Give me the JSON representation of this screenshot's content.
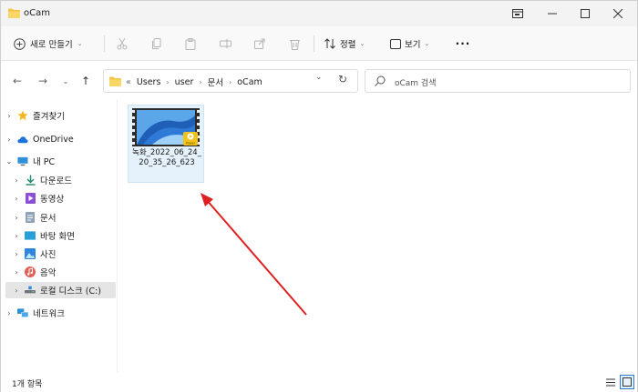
{
  "window": {
    "title": "oCam"
  },
  "toolbar": {
    "new_label": "새로 만들기",
    "sort_label": "정렬",
    "view_label": "보기"
  },
  "address": {
    "overflow": "«",
    "crumbs": [
      "Users",
      "user",
      "문서",
      "oCam"
    ]
  },
  "search": {
    "placeholder": "oCam 검색"
  },
  "sidebar": {
    "items": [
      {
        "label": "즐겨찾기",
        "icon": "star-icon"
      },
      {
        "label": "OneDrive",
        "icon": "cloud-icon"
      },
      {
        "label": "내 PC",
        "icon": "pc-icon"
      },
      {
        "label": "다운로드",
        "icon": "download-icon"
      },
      {
        "label": "동영상",
        "icon": "video-icon"
      },
      {
        "label": "문서",
        "icon": "document-icon"
      },
      {
        "label": "바탕 화면",
        "icon": "desktop-icon"
      },
      {
        "label": "사진",
        "icon": "pictures-icon"
      },
      {
        "label": "음악",
        "icon": "music-icon"
      },
      {
        "label": "로컬 디스크 (C:)",
        "icon": "drive-icon"
      },
      {
        "label": "네트워크",
        "icon": "network-icon"
      }
    ]
  },
  "files": [
    {
      "name": "녹화_2022_06_24_20_35_26_623",
      "badge": "Player"
    }
  ],
  "status": {
    "count": "1개 항목"
  },
  "colors": {
    "arrow": "#e02020",
    "selection": "#e5f1fb",
    "folder": "#f4c542"
  }
}
